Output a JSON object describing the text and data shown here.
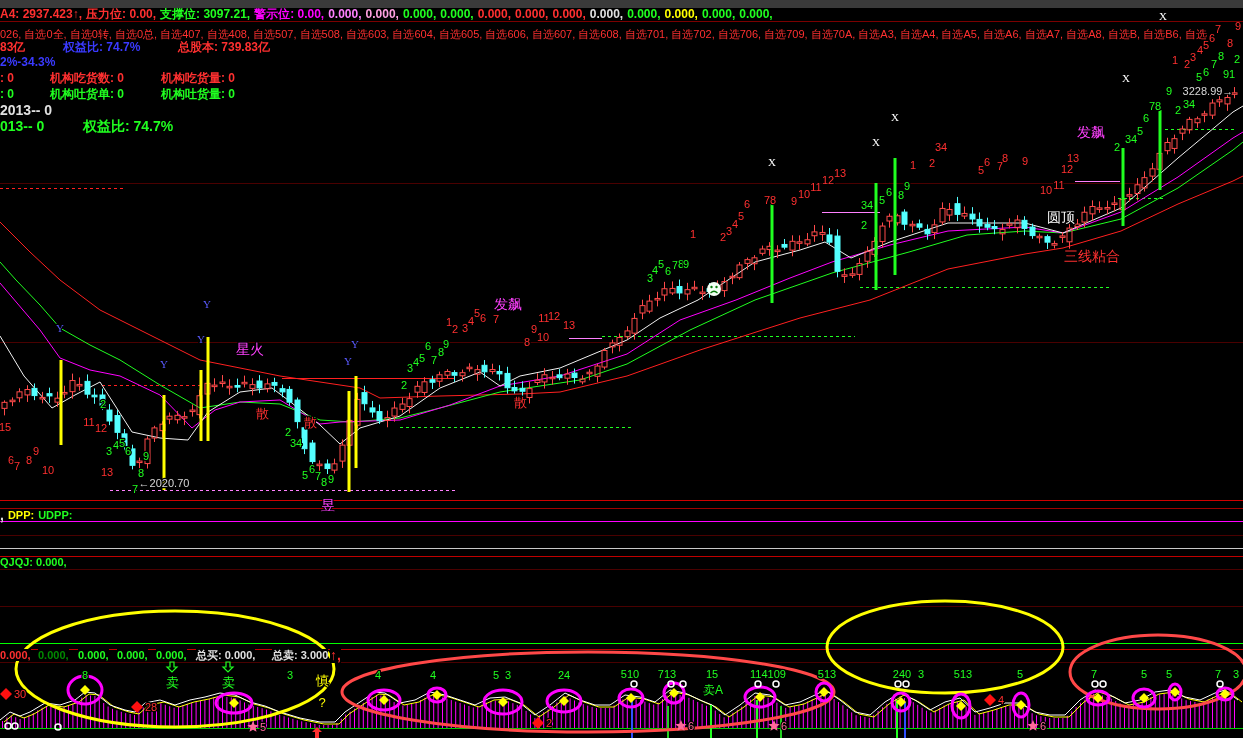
{
  "header": {
    "indicator_values": [
      {
        "text": "A4: 2937.423↑,",
        "color": "#ff3030"
      },
      {
        "text": "压力位: 0.00,",
        "color": "#ff3030"
      },
      {
        "text": "支撑位: 3097.21,",
        "color": "#20ff20"
      },
      {
        "text": "警示位: 0.00,",
        "color": "#ff00ff"
      },
      {
        "text": "0.000,",
        "color": "#ff80ff"
      },
      {
        "text": "0.000,",
        "color": "#ffa0e0"
      },
      {
        "text": "0.000,",
        "color": "#20ff20"
      },
      {
        "text": "0.000,",
        "color": "#20ff20"
      },
      {
        "text": "0.000,",
        "color": "#ff3030"
      },
      {
        "text": "0.000,",
        "color": "#ff3030"
      },
      {
        "text": "0.000,",
        "color": "#ff3030"
      },
      {
        "text": "0.000,",
        "color": "#e0e0e0"
      },
      {
        "text": "0.000,",
        "color": "#20ff20"
      },
      {
        "text": "0.000,",
        "color": "#ffff00"
      },
      {
        "text": "0.000,",
        "color": "#20ff20"
      },
      {
        "text": "0.000,",
        "color": "#20ff20"
      }
    ],
    "indicator_list": "026, 自选0全, 自选0转, 自选0总, 自选407, 自选408, 自选507, 自选508, 自选603, 自选604, 自选605, 自选606, 自选607, 自选608, 自选701, 自选702, 自选706, 自选709, 自选70A, 自选A3, 自选A4, 自选A5, 自选A6, 自选A7, 自选A8, 自选B, 自选B6, 自选",
    "info_rows": [
      [
        {
          "text": "83亿",
          "color": "#ff3030"
        },
        {
          "text": "权益比: 74.7%",
          "color": "#3a3aff"
        },
        {
          "text": "总股本: 739.83亿",
          "color": "#ff3030"
        }
      ],
      [
        {
          "text": "2%-34.3%",
          "color": "#3a3aff"
        }
      ],
      [
        {
          "text": ": 0",
          "color": "#ff3030"
        },
        {
          "text": "机构吃货数: 0",
          "color": "#ff3030"
        },
        {
          "text": "机构吃货量: 0",
          "color": "#ff3030"
        }
      ],
      [
        {
          "text": ": 0",
          "color": "#20ff20"
        },
        {
          "text": "机构吐货单: 0",
          "color": "#20ff20"
        },
        {
          "text": "机构吐货量: 0",
          "color": "#20ff20"
        }
      ],
      [
        {
          "text": "2013-- 0",
          "color": "#e0e0e0"
        }
      ],
      [
        {
          "text": "013-- 0",
          "color": "#20ff20"
        },
        {
          "text": "权益比: 74.7%",
          "color": "#20ff20"
        }
      ]
    ]
  },
  "main_chart": {
    "labels": [
      {
        "text": "15",
        "kind": "up"
      },
      {
        "text": "6",
        "kind": "up"
      },
      {
        "text": "7",
        "kind": "up"
      },
      {
        "text": "8",
        "kind": "up"
      },
      {
        "text": "9",
        "kind": "up"
      },
      {
        "text": "10",
        "kind": "up"
      },
      {
        "text": "Y",
        "kind": "buy"
      },
      {
        "text": "11",
        "kind": "up"
      },
      {
        "text": "2",
        "kind": "down"
      },
      {
        "text": "12",
        "kind": "up"
      },
      {
        "text": "3",
        "kind": "down"
      },
      {
        "text": "13",
        "kind": "up"
      },
      {
        "text": "4",
        "kind": "down"
      },
      {
        "text": "5",
        "kind": "down"
      },
      {
        "text": "6",
        "kind": "down"
      },
      {
        "text": "7",
        "kind": "down"
      },
      {
        "text": "8",
        "kind": "down"
      },
      {
        "text": "9",
        "kind": "down"
      },
      {
        "text": "Y",
        "kind": "buy"
      },
      {
        "text": "←2020.70",
        "kind": "price"
      },
      {
        "text": "Y",
        "kind": "buy"
      },
      {
        "text": "Y",
        "kind": "buy"
      },
      {
        "text": "星火",
        "kind": "pattern"
      },
      {
        "text": "散",
        "kind": "scatter"
      },
      {
        "text": "2",
        "kind": "down"
      },
      {
        "text": "34",
        "kind": "down"
      },
      {
        "text": "散",
        "kind": "scatter"
      },
      {
        "text": "5",
        "kind": "down"
      },
      {
        "text": "6",
        "kind": "down"
      },
      {
        "text": "7",
        "kind": "down"
      },
      {
        "text": "8",
        "kind": "down"
      },
      {
        "text": "9",
        "kind": "down"
      },
      {
        "text": "昱",
        "kind": "pattern"
      },
      {
        "text": "Y",
        "kind": "buy"
      },
      {
        "text": "Y",
        "kind": "buy"
      },
      {
        "text": "2",
        "kind": "down"
      },
      {
        "text": "3",
        "kind": "down"
      },
      {
        "text": "4",
        "kind": "down"
      },
      {
        "text": "5",
        "kind": "down"
      },
      {
        "text": "6",
        "kind": "down"
      },
      {
        "text": "7",
        "kind": "down"
      },
      {
        "text": "8",
        "kind": "down"
      },
      {
        "text": "1",
        "kind": "up"
      },
      {
        "text": "9",
        "kind": "down"
      },
      {
        "text": "2",
        "kind": "up"
      },
      {
        "text": "3",
        "kind": "up"
      },
      {
        "text": "4",
        "kind": "up"
      },
      {
        "text": "5",
        "kind": "up"
      },
      {
        "text": "6",
        "kind": "up"
      },
      {
        "text": "发飙",
        "kind": "pattern"
      },
      {
        "text": "7",
        "kind": "up"
      },
      {
        "text": "8",
        "kind": "up"
      },
      {
        "text": "散",
        "kind": "scatter"
      },
      {
        "text": "9",
        "kind": "up"
      },
      {
        "text": "11",
        "kind": "up"
      },
      {
        "text": "10",
        "kind": "up"
      },
      {
        "text": "12",
        "kind": "up"
      },
      {
        "text": "13",
        "kind": "up"
      },
      {
        "text": "3",
        "kind": "down"
      },
      {
        "text": "4",
        "kind": "down"
      },
      {
        "text": "5",
        "kind": "down"
      },
      {
        "text": "6",
        "kind": "down"
      },
      {
        "text": "7",
        "kind": "down"
      },
      {
        "text": "8",
        "kind": "down"
      },
      {
        "text": "9",
        "kind": "down"
      },
      {
        "text": "1",
        "kind": "up"
      },
      {
        "text": "2",
        "kind": "up"
      },
      {
        "text": "3",
        "kind": "up"
      },
      {
        "text": "4",
        "kind": "up"
      },
      {
        "text": "5",
        "kind": "up"
      },
      {
        "text": "6",
        "kind": "up"
      },
      {
        "text": "X",
        "kind": "sell"
      },
      {
        "text": "78",
        "kind": "up"
      },
      {
        "text": "9",
        "kind": "up"
      },
      {
        "text": "10",
        "kind": "up"
      },
      {
        "text": "11",
        "kind": "up"
      },
      {
        "text": "12",
        "kind": "up"
      },
      {
        "text": "13",
        "kind": "up"
      },
      {
        "text": "2",
        "kind": "down"
      },
      {
        "text": "X",
        "kind": "sell"
      },
      {
        "text": "34",
        "kind": "down"
      },
      {
        "text": "5",
        "kind": "down"
      },
      {
        "text": "X",
        "kind": "sell"
      },
      {
        "text": "6",
        "kind": "down"
      },
      {
        "text": "8",
        "kind": "down"
      },
      {
        "text": "9",
        "kind": "down"
      },
      {
        "text": "1",
        "kind": "up"
      },
      {
        "text": "2",
        "kind": "up"
      },
      {
        "text": "34",
        "kind": "up"
      },
      {
        "text": "5",
        "kind": "up"
      },
      {
        "text": "6",
        "kind": "up"
      },
      {
        "text": "7",
        "kind": "up"
      },
      {
        "text": "8",
        "kind": "up"
      },
      {
        "text": "9",
        "kind": "up"
      },
      {
        "text": "10",
        "kind": "up"
      },
      {
        "text": "11",
        "kind": "up"
      },
      {
        "text": "12",
        "kind": "up"
      },
      {
        "text": "13",
        "kind": "up"
      },
      {
        "text": "圆顶",
        "kind": "note"
      },
      {
        "text": "发飙",
        "kind": "pattern"
      },
      {
        "text": "2",
        "kind": "down"
      },
      {
        "text": "三线粘合",
        "kind": "alert"
      },
      {
        "text": "X",
        "kind": "sell"
      },
      {
        "text": "34",
        "kind": "down"
      },
      {
        "text": "5",
        "kind": "down"
      },
      {
        "text": "6",
        "kind": "down"
      },
      {
        "text": "X",
        "kind": "sell"
      },
      {
        "text": "78",
        "kind": "down"
      },
      {
        "text": "9",
        "kind": "down"
      },
      {
        "text": "1",
        "kind": "up"
      },
      {
        "text": "2",
        "kind": "up"
      },
      {
        "text": "3",
        "kind": "up"
      },
      {
        "text": "4",
        "kind": "up"
      },
      {
        "text": "5",
        "kind": "up"
      },
      {
        "text": "6",
        "kind": "up"
      },
      {
        "text": "7",
        "kind": "up"
      },
      {
        "text": "8",
        "kind": "up"
      },
      {
        "text": "9",
        "kind": "up"
      },
      {
        "text": "5",
        "kind": "down"
      },
      {
        "text": "6",
        "kind": "down"
      },
      {
        "text": "7",
        "kind": "down"
      },
      {
        "text": "8",
        "kind": "down"
      },
      {
        "text": "91",
        "kind": "down"
      },
      {
        "text": "2",
        "kind": "down"
      },
      {
        "text": "3228.99→",
        "kind": "price"
      },
      {
        "text": "2",
        "kind": "down"
      },
      {
        "text": "34",
        "kind": "down"
      }
    ]
  },
  "dpp_panel": {
    "values": [
      {
        "text": ",",
        "color": "#e0e0e0",
        "kind": "mark"
      },
      {
        "text": "DPP:",
        "color": "#ffff00",
        "kind": "value"
      },
      {
        "text": "UDPP:",
        "color": "#20ff20",
        "kind": "value"
      }
    ]
  },
  "qjqj_panel": {
    "values": [
      {
        "text": "QJQJ: 0.000,",
        "color": "#20ff20"
      }
    ]
  },
  "signal_panel": {
    "values": [
      {
        "text": "0.000,",
        "color": "#ff3030",
        "kind": "value"
      },
      {
        "text": "0.000,",
        "color": "#008a00",
        "kind": "value"
      },
      {
        "text": "0.000,",
        "color": "#20ff20",
        "kind": "value"
      },
      {
        "text": "0.000,",
        "color": "#20ff20",
        "kind": "value"
      },
      {
        "text": "0.000,",
        "color": "#20ff20",
        "kind": "value"
      },
      {
        "text": "总买: 0.000,",
        "color": "#e0e0e0",
        "kind": "value"
      },
      {
        "text": "总卖: 3.000",
        "color": "#e0e0e0",
        "kind": "value"
      },
      {
        "text": "↑,",
        "color": "#ff3030",
        "kind": "mark"
      }
    ],
    "labels": [
      {
        "text": "30",
        "kind": "diamond"
      },
      {
        "text": "8",
        "kind": "count"
      },
      {
        "text": "28",
        "kind": "diamond"
      },
      {
        "text": "卖",
        "kind": "sell"
      },
      {
        "text": "卖",
        "kind": "sell"
      },
      {
        "text": "5",
        "kind": "star"
      },
      {
        "text": "3",
        "kind": "count"
      },
      {
        "text": "慎",
        "kind": "caution"
      },
      {
        "text": "?",
        "kind": "caution"
      },
      {
        "text": "4",
        "kind": "count"
      },
      {
        "text": "4",
        "kind": "count"
      },
      {
        "text": "5",
        "kind": "count"
      },
      {
        "text": "3",
        "kind": "count"
      },
      {
        "text": "2",
        "kind": "diamond"
      },
      {
        "text": "24",
        "kind": "count"
      },
      {
        "text": "510",
        "kind": "count"
      },
      {
        "text": "713",
        "kind": "count"
      },
      {
        "text": "6",
        "kind": "star"
      },
      {
        "text": "15",
        "kind": "count"
      },
      {
        "text": "卖A",
        "kind": "sellplain"
      },
      {
        "text": "114109",
        "kind": "count"
      },
      {
        "text": "6",
        "kind": "star"
      },
      {
        "text": "513",
        "kind": "count"
      },
      {
        "text": "240",
        "kind": "count"
      },
      {
        "text": "3",
        "kind": "count"
      },
      {
        "text": "513",
        "kind": "count"
      },
      {
        "text": "4",
        "kind": "diamond"
      },
      {
        "text": "5",
        "kind": "count"
      },
      {
        "text": "6",
        "kind": "star"
      },
      {
        "text": "7",
        "kind": "count"
      },
      {
        "text": "5",
        "kind": "count"
      },
      {
        "text": "5",
        "kind": "count"
      },
      {
        "text": "7",
        "kind": "count"
      },
      {
        "text": "3",
        "kind": "count"
      }
    ]
  }
}
